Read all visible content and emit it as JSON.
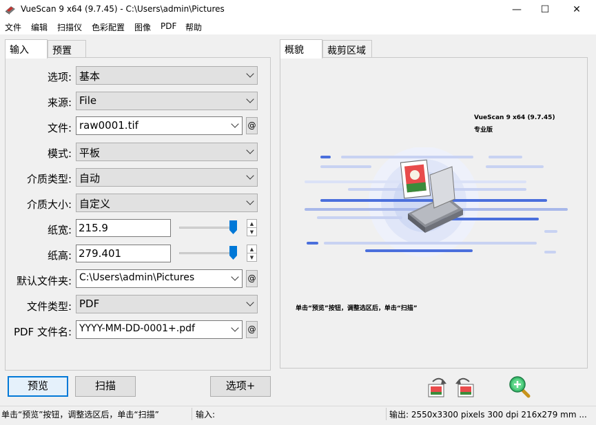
{
  "window": {
    "title": "VueScan 9 x64 (9.7.45) - C:\\Users\\admin\\Pictures",
    "minimize": "—",
    "maximize": "☐",
    "close": "✕"
  },
  "menu": [
    "文件",
    "编辑",
    "扫描仪",
    "色彩配置",
    "图像",
    "PDF",
    "帮助"
  ],
  "left_tabs": [
    "输入",
    "预置"
  ],
  "right_tabs": [
    "概貌",
    "裁剪区域"
  ],
  "form": {
    "options": {
      "label": "选项:",
      "value": "基本"
    },
    "source": {
      "label": "来源:",
      "value": "File"
    },
    "file": {
      "label": "文件:",
      "value": "raw0001.tif"
    },
    "mode": {
      "label": "模式:",
      "value": "平板"
    },
    "media_type": {
      "label": "介质类型:",
      "value": "自动"
    },
    "media_size": {
      "label": "介质大小:",
      "value": "自定义"
    },
    "width": {
      "label": "纸宽:",
      "value": "215.9"
    },
    "height": {
      "label": "纸高:",
      "value": "279.401"
    },
    "default_folder": {
      "label": "默认文件夹:",
      "value": "C:\\Users\\admin\\Pictures"
    },
    "file_type": {
      "label": "文件类型:",
      "value": "PDF"
    },
    "pdf_filename": {
      "label": "PDF 文件名:",
      "value": "YYYY-MM-DD-0001+.pdf"
    },
    "at_symbol": "@",
    "spin_up": "▲",
    "spin_down": "▼"
  },
  "preview": {
    "app_name": "VueScan 9 x64 (9.7.45)",
    "edition": "专业版",
    "hint": "单击“预览”按钮，调整选区后，单击“扫描”"
  },
  "buttons": {
    "preview": "预览",
    "scan": "扫描",
    "options_more": "选项+"
  },
  "status": {
    "hint": "单击“预览”按钮，调整选区后，单击“扫描”",
    "input": "输入:",
    "output": "输出: 2550x3300 pixels 300 dpi 216x279 mm ..."
  },
  "colors": {
    "accent": "#0078d7",
    "scan_lines": "#4a6fdc"
  }
}
